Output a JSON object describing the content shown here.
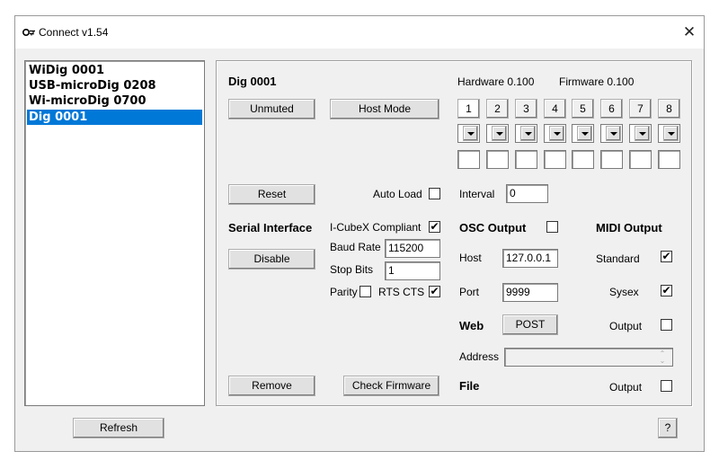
{
  "window": {
    "title": "Connect v1.54",
    "close_glyph": "✕"
  },
  "devices": [
    "WiDig 0001",
    "USB-microDig 0208",
    "Wi-microDig 0700",
    "Dig 0001"
  ],
  "selected_device": "Dig 0001",
  "panel": {
    "device_name": "Dig 0001",
    "hardware": "Hardware 0.100",
    "firmware": "Firmware 0.100",
    "buttons": {
      "unmuted": "Unmuted",
      "host_mode": "Host Mode",
      "reset": "Reset",
      "disable": "Disable",
      "remove": "Remove",
      "check_firmware": "Check Firmware",
      "post": "POST"
    },
    "channels": [
      "1",
      "2",
      "3",
      "4",
      "5",
      "6",
      "7",
      "8"
    ],
    "auto_load_label": "Auto Load",
    "interval_label": "Interval",
    "interval_value": "0",
    "serial": {
      "heading": "Serial Interface",
      "icube_label": "I-CubeX Compliant",
      "icube_checked": "✔",
      "baud_label": "Baud Rate",
      "baud_value": "115200",
      "stop_label": "Stop Bits",
      "stop_value": "1",
      "parity_label": "Parity",
      "rtscts_label": "RTS CTS",
      "rtscts_checked": "✔"
    },
    "osc": {
      "heading": "OSC Output",
      "host_label": "Host",
      "host_value": "127.0.0.1",
      "port_label": "Port",
      "port_value": "9999"
    },
    "midi": {
      "heading": "MIDI Output",
      "standard_label": "Standard",
      "standard_checked": "✔",
      "sysex_label": "Sysex",
      "sysex_checked": "✔"
    },
    "web": {
      "heading": "Web",
      "output_label": "Output",
      "address_label": "Address",
      "address_value": ""
    },
    "file": {
      "heading": "File",
      "output_label": "Output"
    }
  },
  "footer": {
    "refresh": "Refresh",
    "help": "?"
  }
}
